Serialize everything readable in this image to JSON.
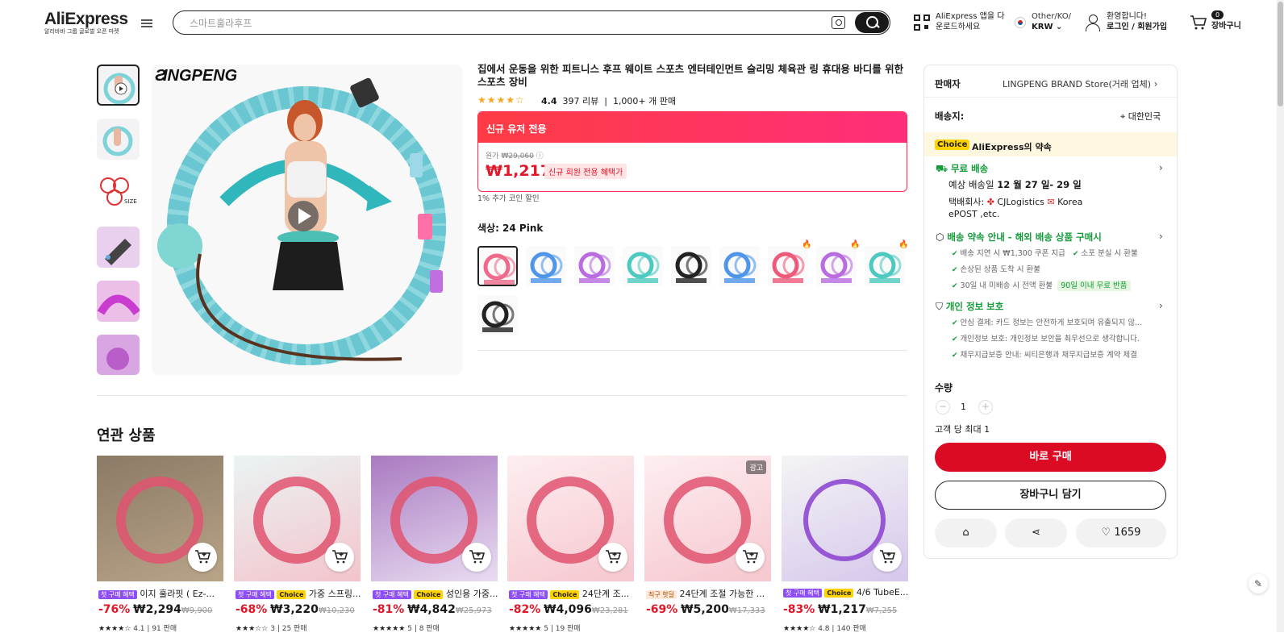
{
  "header": {
    "logo": "AliExpress",
    "logo_sub": "알리바바 그룹 글로벌 오픈 마켓",
    "search_placeholder": "스마트훌라후프",
    "app_line1": "AliExpress 앱을 다",
    "app_line2": "운로드하세요",
    "region_line1": "Other/KO/",
    "region_line2": "KRW",
    "welcome": "환영합니다!",
    "login": "로그인 / 회원가입",
    "cart_count": "0",
    "cart_label": "장바구니"
  },
  "gallery": {
    "brand": "INGPENG",
    "brand_mark": "Ƨ"
  },
  "product": {
    "title": "집에서 운동을 위한 피트니스 후프 웨이트 스포츠 엔터테인먼트 슬리밍 체육관 링 휴대용 바디를 위한 스포츠 장비",
    "stars": "★★★★☆",
    "rating": "4.4",
    "reviews": "397 리뷰",
    "sold": "1,000+ 개 판매",
    "promo_header": "신규 유저 전용",
    "orig_label": "원가",
    "orig_price": "₩29,060",
    "price": "₩1,217",
    "new_tag": "신규 회원 전용 혜택가",
    "coin": "1% 추가 코인 할인",
    "color_label": "색상: 24 Pink"
  },
  "panel": {
    "seller_label": "판매자",
    "seller_value": "LINGPENG BRAND Store(거래 업체)",
    "ship_label": "배송지:",
    "ship_value": "대한민국",
    "choice_tag": "Choice",
    "choice_text": "AliExpress의 약속",
    "free_ship": "무료 배송",
    "eta_prefix": "예상 배송일",
    "eta": "12 월 27 일- 29 일",
    "carrier_label": "택배회사:",
    "carrier1": "CJLogistics",
    "carrier2": "Korea",
    "carrier3": "ePOST ,etc.",
    "promise": "배송 약속 안내 - 해외 배송 상품 구매시",
    "promise_items": [
      "배송 지연 시 ₩1,300 쿠폰 지급",
      "소포 분실 시 환불",
      "손상된 상품 도착 시 환불",
      "30일 내 미배송 시 전액 환불"
    ],
    "return_tag": "90일 이내 무료 반품",
    "privacy": "개인 정보 보호",
    "privacy_items": [
      "안심 결제: 카드 정보는 안전하게 보호되며 유출되지 않...",
      "개인정보 보호: 개인정보 보안을 최우선으로 생각합니다.",
      "채무지급보증 안내: 씨티은행과 채무지급보증 계약 체결"
    ],
    "qty_label": "수량",
    "qty": "1",
    "qty_minus": "−",
    "qty_plus": "+",
    "max_per": "고객 당 최대 1",
    "buy_now": "바로 구매",
    "add_cart": "장바구니 담기",
    "wish_count": "1659"
  },
  "related": {
    "title": "연관 상품",
    "items": [
      {
        "tag1": "첫 구매 혜택",
        "tag2": "",
        "name": "이지 훌라핏 ( Ez-...",
        "discount": "-76%",
        "price": "₩2,294",
        "old": "₩9,900",
        "stars": "★★★★☆",
        "rating": "4.1",
        "sold": "91 판매",
        "ad": ""
      },
      {
        "tag1": "첫 구매 혜택",
        "tag2": "Choice",
        "name": "가중 스프링...",
        "discount": "-68%",
        "price": "₩3,220",
        "old": "₩10,230",
        "stars": "★★★☆☆",
        "rating": "3",
        "sold": "25 판매",
        "ad": ""
      },
      {
        "tag1": "첫 구매 혜택",
        "tag2": "Choice",
        "name": "성인용 가중...",
        "discount": "-81%",
        "price": "₩4,842",
        "old": "₩25,973",
        "stars": "★★★★★",
        "rating": "5",
        "sold": "8 판매",
        "ad": ""
      },
      {
        "tag1": "첫 구매 혜택",
        "tag2": "Choice",
        "name": "24단계 조...",
        "discount": "-82%",
        "price": "₩4,096",
        "old": "₩23,281",
        "stars": "★★★★★",
        "rating": "5",
        "sold": "19 판매",
        "ad": ""
      },
      {
        "tag1": "직구 핫딜",
        "tag2": "",
        "name": "24단계 조절 가능한 ...",
        "discount": "-69%",
        "price": "₩5,200",
        "old": "₩17,333",
        "stars": "",
        "rating": "",
        "sold": "",
        "ad": "광고"
      },
      {
        "tag1": "첫 구매 혜택",
        "tag2": "Choice",
        "name": "4/6 TubeE...",
        "discount": "-83%",
        "price": "₩1,217",
        "old": "₩7,255",
        "stars": "★★★★☆",
        "rating": "4.8",
        "sold": "140 판매",
        "ad": ""
      }
    ]
  },
  "colors": {
    "accent_red": "#db0b23",
    "promo_gradient": "#ff3c44",
    "choice_yellow": "#ffd200",
    "green": "#139c39"
  }
}
